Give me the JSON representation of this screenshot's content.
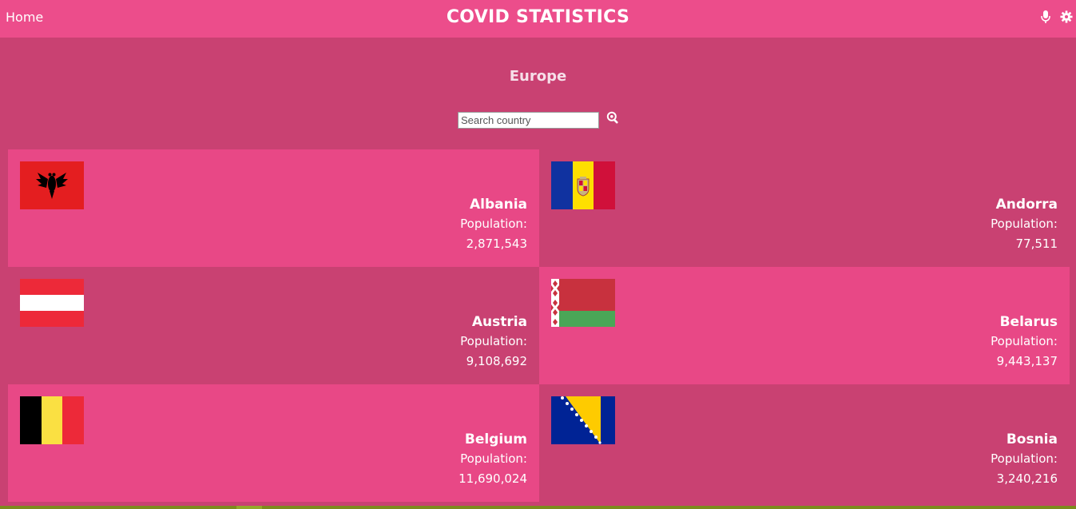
{
  "header": {
    "home_label": "Home",
    "title": "COVID STATISTICS",
    "icons": [
      "microphone-icon",
      "gear-icon"
    ]
  },
  "main": {
    "region": "Europe",
    "search": {
      "placeholder": "Search country",
      "value": "",
      "button_icon": "search-icon"
    }
  },
  "countries": [
    {
      "name": "Albania",
      "population_label": "Population:",
      "population": "2,871,543",
      "flag": "albania-flag"
    },
    {
      "name": "Andorra",
      "population_label": "Population:",
      "population": "77,511",
      "flag": "andorra-flag"
    },
    {
      "name": "Austria",
      "population_label": "Population:",
      "population": "9,108,692",
      "flag": "austria-flag"
    },
    {
      "name": "Belarus",
      "population_label": "Population:",
      "population": "9,443,137",
      "flag": "belarus-flag"
    },
    {
      "name": "Belgium",
      "population_label": "Population:",
      "population": "11,690,024",
      "flag": "belgium-flag"
    },
    {
      "name": "Bosnia",
      "population_label": "Population:",
      "population": "3,240,216",
      "flag": "bosnia-flag"
    }
  ],
  "colors": {
    "header": "#ec4d8b",
    "background": "#c94172",
    "card_light": "#e84886",
    "card_dark": "#c94172"
  }
}
